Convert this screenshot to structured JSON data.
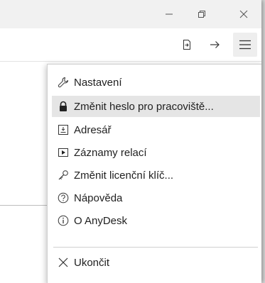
{
  "menu": {
    "items": [
      {
        "id": "settings",
        "label": "Nastavení",
        "icon": "wrench-icon"
      },
      {
        "id": "change-password",
        "label": "Změnit heslo pro pracoviště...",
        "icon": "lock-icon"
      },
      {
        "id": "address-book",
        "label": "Adresář",
        "icon": "address-book-icon"
      },
      {
        "id": "session-recordings",
        "label": "Záznamy relací",
        "icon": "play-recording-icon"
      },
      {
        "id": "change-license",
        "label": "Změnit licenční klíč...",
        "icon": "key-icon"
      },
      {
        "id": "help",
        "label": "Nápověda",
        "icon": "help-circle-icon"
      },
      {
        "id": "about",
        "label": "O AnyDesk",
        "icon": "info-circle-icon"
      },
      {
        "id": "exit",
        "label": "Ukončit",
        "icon": "close-x-icon"
      }
    ],
    "highlighted": "change-password"
  },
  "colors": {
    "highlight": "#e5e5e5",
    "text": "#1f1f1f"
  }
}
